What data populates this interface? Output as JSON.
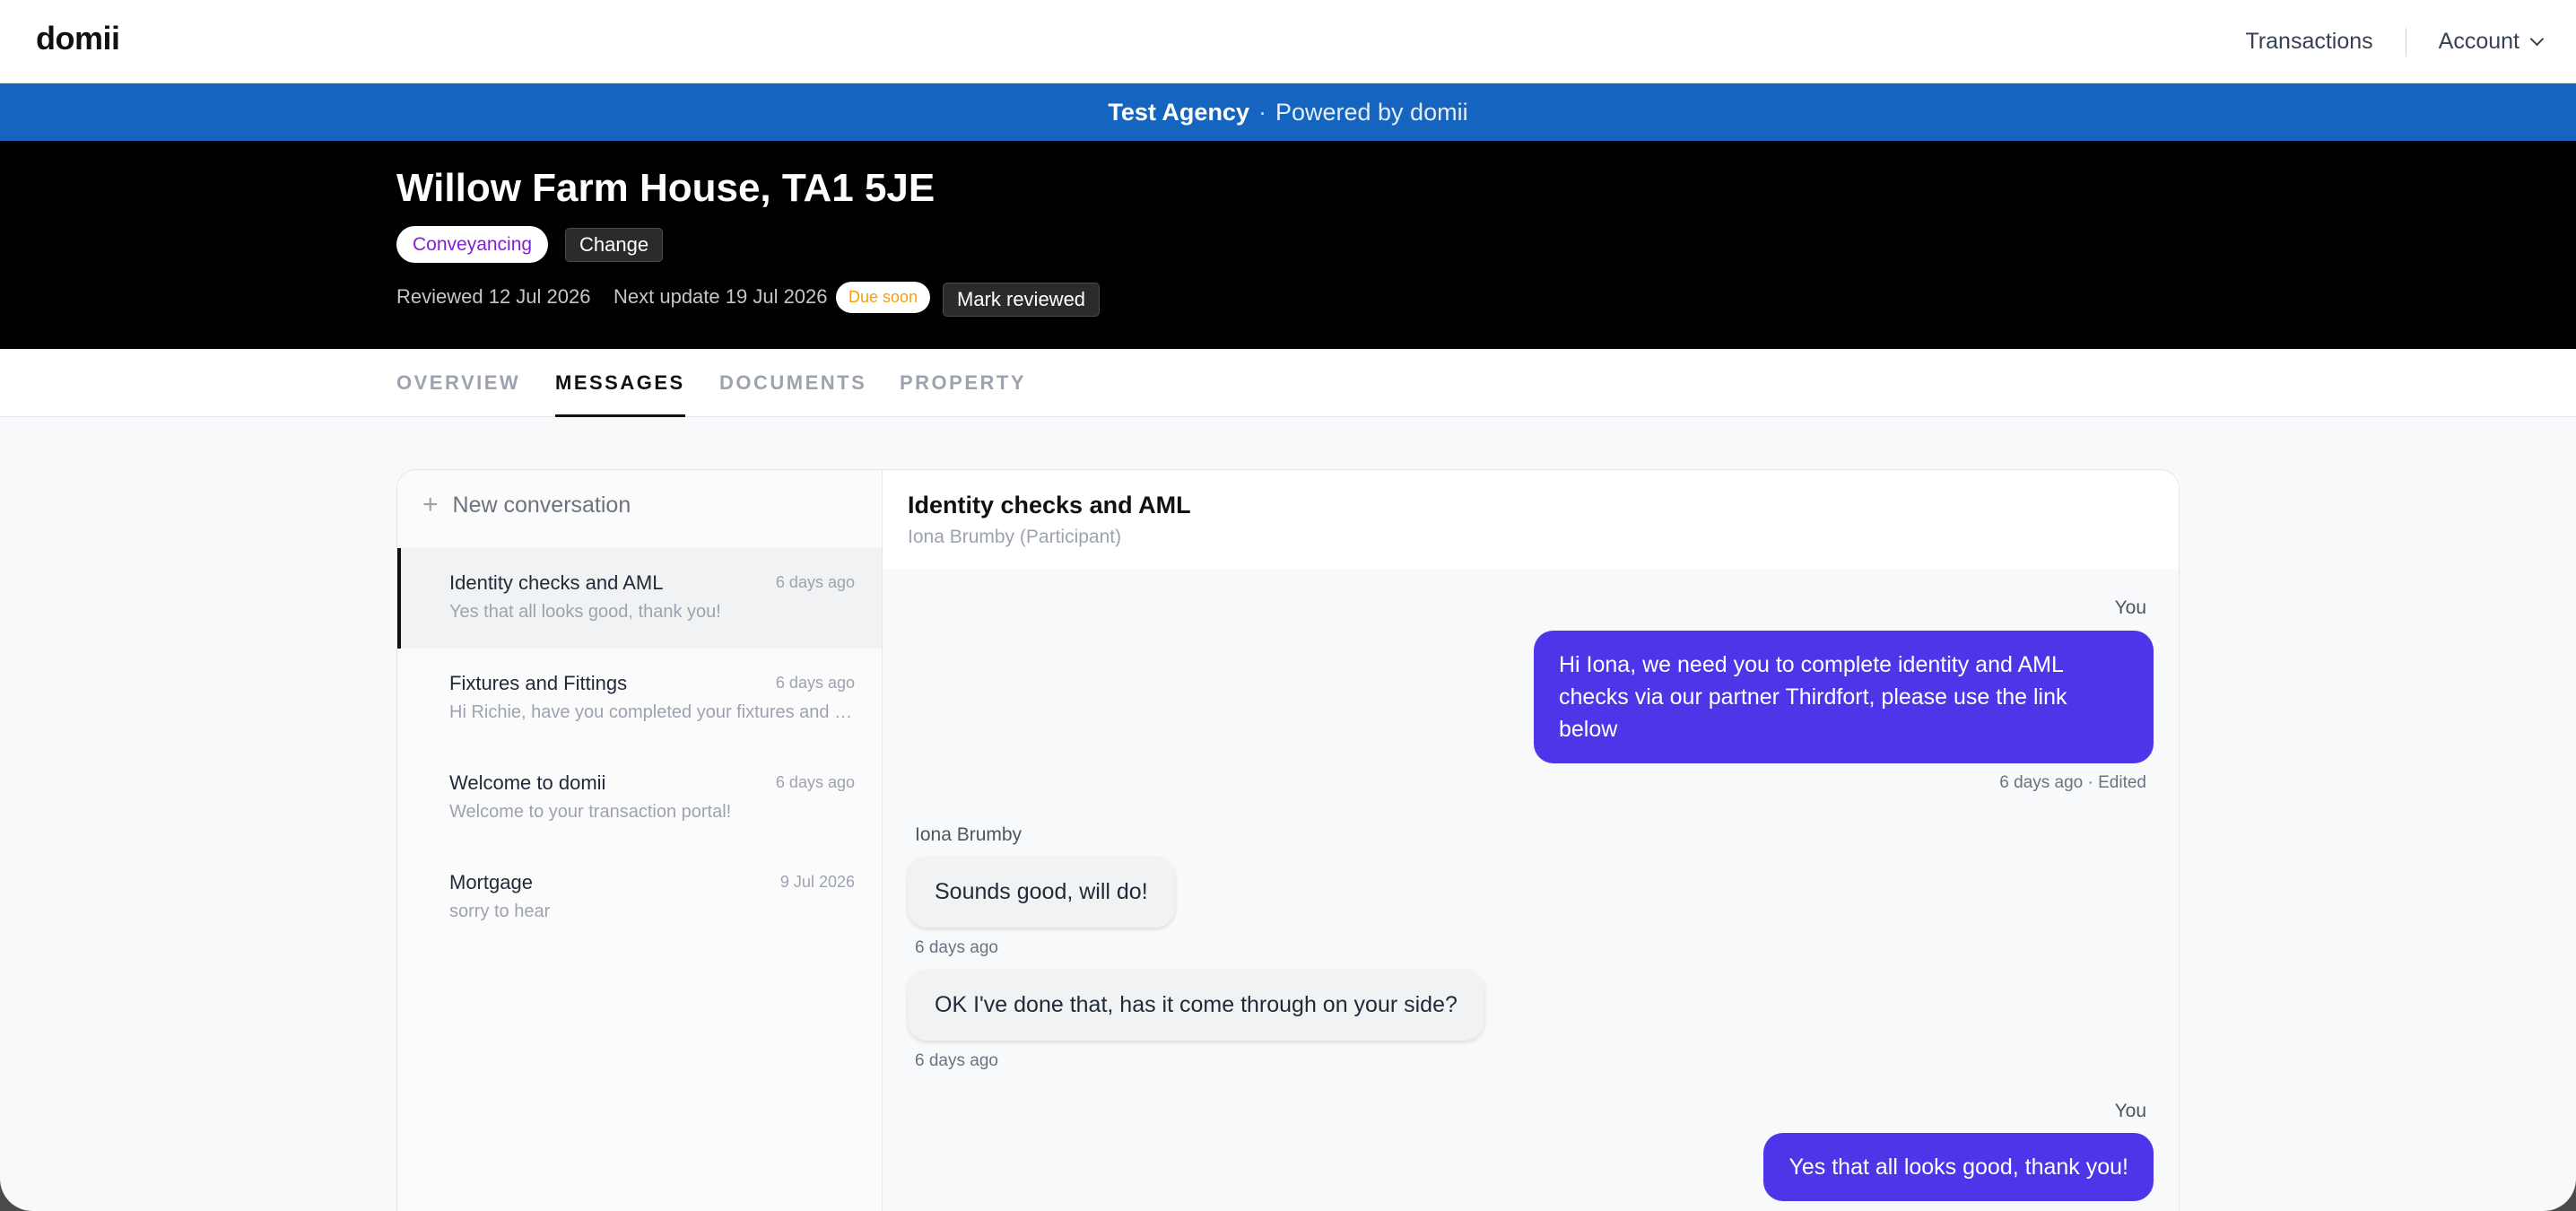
{
  "app": {
    "logo": "domii",
    "nav": {
      "transactions": "Transactions",
      "account": "Account"
    }
  },
  "agency": {
    "name": "Test Agency",
    "separator": "·",
    "powered": "Powered by domii"
  },
  "property": {
    "title": "Willow Farm House, TA1 5JE",
    "service": "Conveyancing",
    "change_label": "Change",
    "reviewed": "Reviewed 12 Jul 2026",
    "next_update": "Next update 19 Jul 2026",
    "due_badge": "Due soon",
    "mark_reviewed_label": "Mark reviewed"
  },
  "tabs": [
    {
      "label": "OVERVIEW",
      "active": false
    },
    {
      "label": "MESSAGES",
      "active": true
    },
    {
      "label": "DOCUMENTS",
      "active": false
    },
    {
      "label": "PROPERTY",
      "active": false
    }
  ],
  "conversations": {
    "new_label": "New conversation",
    "items": [
      {
        "title": "Identity checks and AML",
        "time": "6 days ago",
        "snippet": "Yes that all looks good, thank you!",
        "active": true
      },
      {
        "title": "Fixtures and Fittings",
        "time": "6 days ago",
        "snippet": "Hi Richie, have you completed your fixtures and fittings",
        "active": false
      },
      {
        "title": "Welcome to domii",
        "time": "6 days ago",
        "snippet": "Welcome to your transaction portal!",
        "active": false
      },
      {
        "title": "Mortgage",
        "time": "9 Jul 2026",
        "snippet": "sorry to hear",
        "active": false
      }
    ]
  },
  "thread": {
    "title": "Identity checks and AML",
    "subtitle": "Iona Brumby (Participant)",
    "messages": [
      {
        "sender": "You",
        "text": "Hi Iona, we need you to complete identity and AML checks via our partner Thirdfort, please use the link below",
        "time": "6 days ago · Edited"
      },
      {
        "sender": "Iona Brumby",
        "text": "Sounds good, will do!",
        "time": "6 days ago"
      },
      {
        "text": "OK I've done that, has it come through on your side?",
        "time": "6 days ago"
      },
      {
        "sender": "You",
        "text": "Yes that all looks good, thank you!"
      }
    ]
  },
  "colors": {
    "agency_bar": "#1565c0",
    "header_bg": "#000000",
    "outgoing_bubble": "#4f35e8",
    "service_pill_text": "#7e22ce",
    "due_badge_text": "#f59e0b"
  }
}
